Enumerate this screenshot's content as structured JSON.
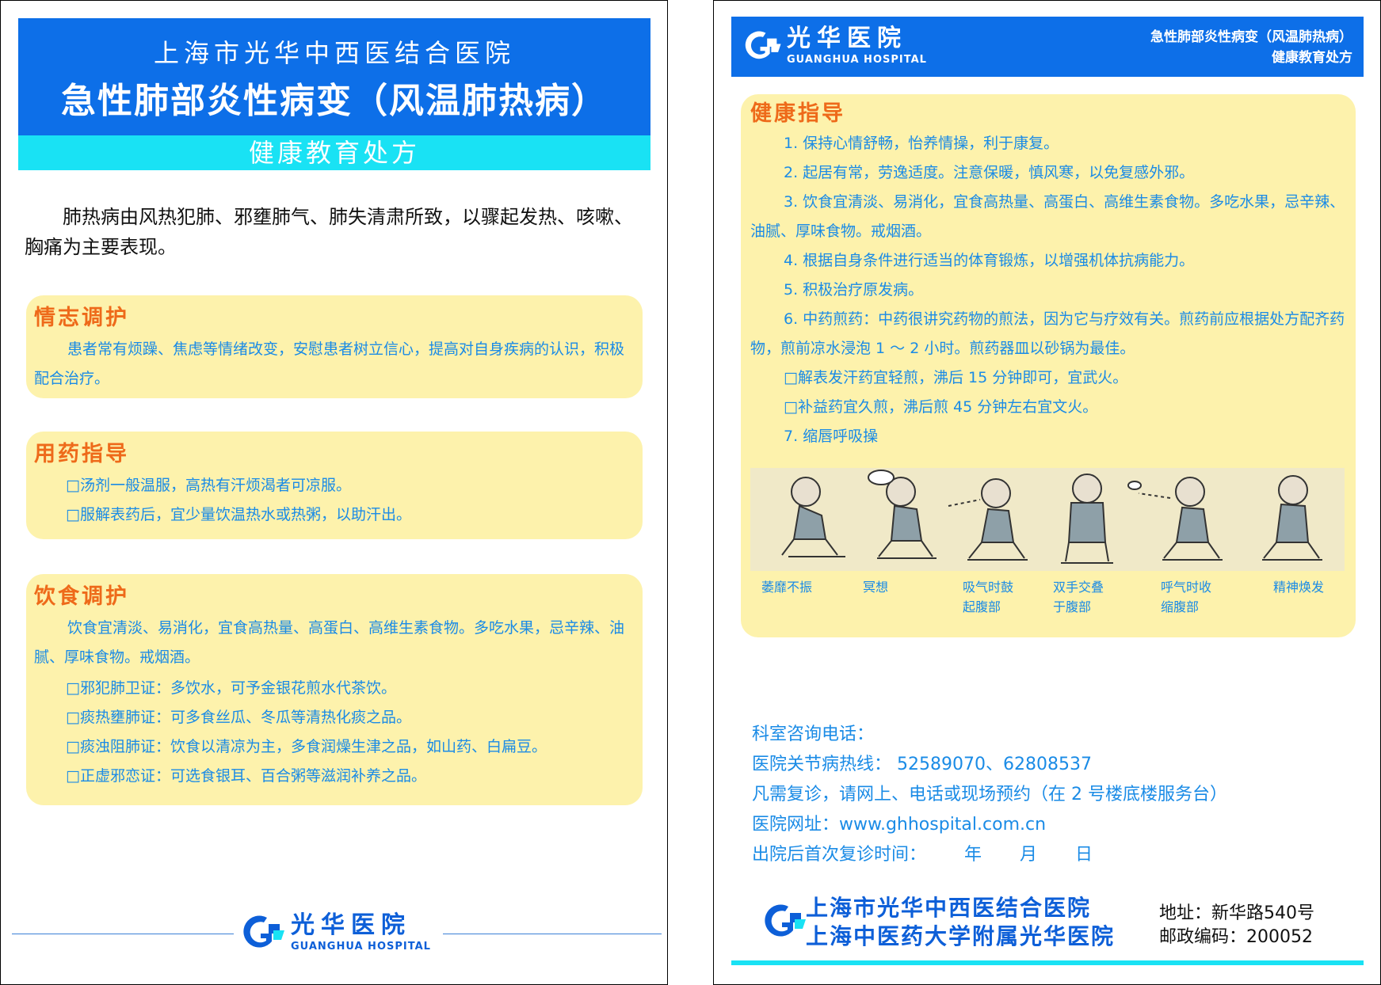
{
  "left": {
    "hospital_name": "上海市光华中西医结合医院",
    "disease_title": "急性肺部炎性病变（风温肺热病）",
    "subtitle": "健康教育处方",
    "intro": "肺热病由风热犯肺、邪壅肺气、肺失清肃所致，以骤起发热、咳嗽、胸痛为主要表现。",
    "sections": [
      {
        "title": "情志调护",
        "paragraphs": [
          "患者常有烦躁、焦虑等情绪改变，安慰患者树立信心，提高对自身疾病的认识，积极配合治疗。"
        ]
      },
      {
        "title": "用药指导",
        "items": [
          "□汤剂一般温服，高热有汗烦渴者可凉服。",
          "□服解表药后，宜少量饮温热水或热粥，以助汗出。"
        ]
      },
      {
        "title": "饮食调护",
        "paragraphs": [
          "饮食宜清淡、易消化，宜食高热量、高蛋白、高维生素食物。多吃水果，忌辛辣、油腻、厚味食物。戒烟酒。"
        ],
        "items": [
          "□邪犯肺卫证：多饮水，可予金银花煎水代茶饮。",
          "□痰热壅肺证：可多食丝瓜、冬瓜等清热化痰之品。",
          "□痰浊阻肺证：饮食以清凉为主，多食润燥生津之品，如山药、白扁豆。",
          "□正虚邪恋证：可选食银耳、百合粥等滋润补养之品。"
        ]
      }
    ],
    "logo": {
      "cn": "光华医院",
      "en": "GUANGHUA HOSPITAL"
    }
  },
  "right": {
    "logo": {
      "cn": "光华医院",
      "en": "GUANGHUA HOSPITAL"
    },
    "header_right": [
      "急性肺部炎性病变（风温肺热病）",
      "健康教育处方"
    ],
    "guide": {
      "title": "健康指导",
      "lines": [
        "1. 保持心情舒畅，怡养情操，利于康复。",
        "2. 起居有常，劳逸适度。注意保暖，慎风寒，以免复感外邪。",
        "3. 饮食宜清淡、易消化，宜食高热量、高蛋白、高维生素食物。多吃水果，忌辛辣、油腻、厚味食物。戒烟酒。",
        "4. 根据自身条件进行适当的体育锻炼，以增强机体抗病能力。",
        "5. 积极治疗原发病。",
        "6. 中药煎药：中药很讲究药物的煎法，因为它与疗效有关。煎药前应根据处方配齐药物，煎前凉水浸泡 1 ～ 2 小时。煎药器皿以砂锅为最佳。",
        "□解表发汗药宜轻煎，沸后 15 分钟即可，宜武火。",
        "□补益药宜久煎，沸后煎 45 分钟左右宜文火。",
        "7. 缩唇呼吸操"
      ],
      "figures": [
        {
          "line1": "萎靡不振",
          "line2": ""
        },
        {
          "line1": "冥想",
          "line2": ""
        },
        {
          "line1": "吸气时鼓",
          "line2": "起腹部"
        },
        {
          "line1": "双手交叠",
          "line2": "于腹部"
        },
        {
          "line1": "呼气时收",
          "line2": "缩腹部"
        },
        {
          "line1": "精神焕发",
          "line2": ""
        }
      ]
    },
    "contact": {
      "l1": "科室咨询电话：",
      "l2": "医院关节病热线：  52589070、62808537",
      "l3": "凡需复诊，请网上、电话或现场预约（在 2 号楼底楼服务台）",
      "l4": "医院网址：www.ghhospital.com.cn",
      "l5_label": "出院后首次复诊时间：",
      "year": "年",
      "month": "月",
      "day": "日"
    },
    "bottom": {
      "name1": "上海市光华中西医结合医院",
      "name2": "上海中医药大学附属光华医院",
      "address": "地址：新华路540号",
      "postcode": "邮政编码：200052"
    }
  },
  "colors": {
    "blue": "#0d6fe8",
    "cyan": "#19e2f4",
    "box": "#fdf2ac",
    "orange": "#ee6a1a",
    "text_blue": "#1a8be6"
  }
}
